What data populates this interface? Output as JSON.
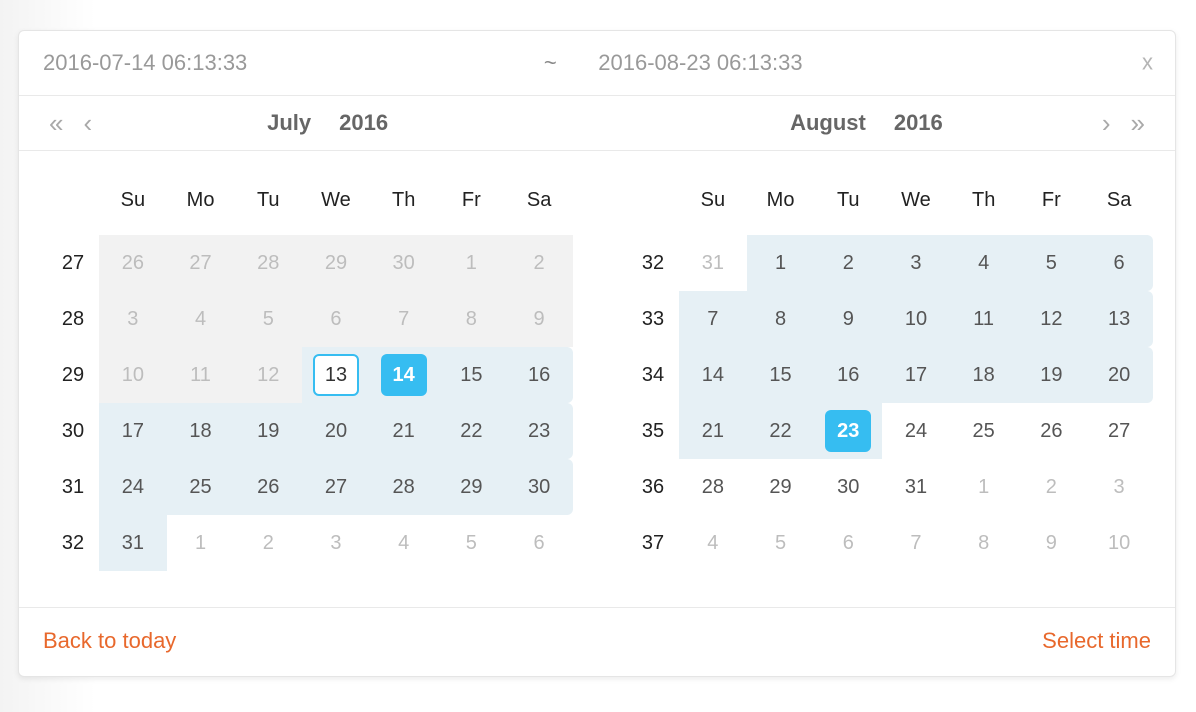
{
  "header": {
    "start_value": "2016-07-14 06:13:33",
    "range_separator": "~",
    "end_value": "2016-08-23 06:13:33",
    "close_label": "x"
  },
  "nav": {
    "prev_year": "«",
    "prev_month": "‹",
    "next_month": "›",
    "next_year": "»",
    "left_month": "July",
    "left_year": "2016",
    "right_month": "August",
    "right_year": "2016"
  },
  "weekdays": [
    "Su",
    "Mo",
    "Tu",
    "We",
    "Th",
    "Fr",
    "Sa"
  ],
  "footer": {
    "back_to_today": "Back to today",
    "select_time": "Select time"
  },
  "calendars": {
    "left": {
      "today": 13,
      "selected": 14,
      "rows": [
        {
          "week": 27,
          "days": [
            {
              "n": 26,
              "out": true,
              "outbg": true
            },
            {
              "n": 27,
              "out": true,
              "outbg": true
            },
            {
              "n": 28,
              "out": true,
              "outbg": true
            },
            {
              "n": 29,
              "out": true,
              "outbg": true
            },
            {
              "n": 30,
              "out": true,
              "outbg": true
            },
            {
              "n": 1,
              "out": true,
              "outbg": true
            },
            {
              "n": 2,
              "out": true,
              "outbg": true
            }
          ]
        },
        {
          "week": 28,
          "days": [
            {
              "n": 3,
              "out": true,
              "outbg": true
            },
            {
              "n": 4,
              "out": true,
              "outbg": true
            },
            {
              "n": 5,
              "out": true,
              "outbg": true
            },
            {
              "n": 6,
              "out": true,
              "outbg": true
            },
            {
              "n": 7,
              "out": true,
              "outbg": true
            },
            {
              "n": 8,
              "out": true,
              "outbg": true
            },
            {
              "n": 9,
              "out": true,
              "outbg": true
            }
          ]
        },
        {
          "week": 29,
          "days": [
            {
              "n": 10,
              "out": true,
              "outbg": true
            },
            {
              "n": 11,
              "out": true,
              "outbg": true
            },
            {
              "n": 12,
              "out": true,
              "outbg": true
            },
            {
              "n": 13,
              "today": true,
              "range": true
            },
            {
              "n": 14,
              "selected": true,
              "range": true
            },
            {
              "n": 15,
              "range": true
            },
            {
              "n": 16,
              "range": true
            }
          ]
        },
        {
          "week": 30,
          "days": [
            {
              "n": 17,
              "range": true
            },
            {
              "n": 18,
              "range": true
            },
            {
              "n": 19,
              "range": true
            },
            {
              "n": 20,
              "range": true
            },
            {
              "n": 21,
              "range": true
            },
            {
              "n": 22,
              "range": true
            },
            {
              "n": 23,
              "range": true
            }
          ]
        },
        {
          "week": 31,
          "days": [
            {
              "n": 24,
              "range": true
            },
            {
              "n": 25,
              "range": true
            },
            {
              "n": 26,
              "range": true
            },
            {
              "n": 27,
              "range": true
            },
            {
              "n": 28,
              "range": true
            },
            {
              "n": 29,
              "range": true
            },
            {
              "n": 30,
              "range": true
            }
          ]
        },
        {
          "week": 32,
          "days": [
            {
              "n": 31,
              "range": true
            },
            {
              "n": 1,
              "out": true
            },
            {
              "n": 2,
              "out": true
            },
            {
              "n": 3,
              "out": true
            },
            {
              "n": 4,
              "out": true
            },
            {
              "n": 5,
              "out": true
            },
            {
              "n": 6,
              "out": true
            }
          ]
        }
      ]
    },
    "right": {
      "selected": 23,
      "rows": [
        {
          "week": 32,
          "days": [
            {
              "n": 31,
              "out": true
            },
            {
              "n": 1,
              "range": true
            },
            {
              "n": 2,
              "range": true
            },
            {
              "n": 3,
              "range": true
            },
            {
              "n": 4,
              "range": true
            },
            {
              "n": 5,
              "range": true
            },
            {
              "n": 6,
              "range": true
            }
          ]
        },
        {
          "week": 33,
          "days": [
            {
              "n": 7,
              "range": true
            },
            {
              "n": 8,
              "range": true
            },
            {
              "n": 9,
              "range": true
            },
            {
              "n": 10,
              "range": true
            },
            {
              "n": 11,
              "range": true
            },
            {
              "n": 12,
              "range": true
            },
            {
              "n": 13,
              "range": true
            }
          ]
        },
        {
          "week": 34,
          "days": [
            {
              "n": 14,
              "range": true
            },
            {
              "n": 15,
              "range": true
            },
            {
              "n": 16,
              "range": true
            },
            {
              "n": 17,
              "range": true
            },
            {
              "n": 18,
              "range": true
            },
            {
              "n": 19,
              "range": true
            },
            {
              "n": 20,
              "range": true
            }
          ]
        },
        {
          "week": 35,
          "days": [
            {
              "n": 21,
              "range": true
            },
            {
              "n": 22,
              "range": true
            },
            {
              "n": 23,
              "selected": true,
              "range": true
            },
            {
              "n": 24
            },
            {
              "n": 25
            },
            {
              "n": 26
            },
            {
              "n": 27
            }
          ]
        },
        {
          "week": 36,
          "days": [
            {
              "n": 28
            },
            {
              "n": 29
            },
            {
              "n": 30
            },
            {
              "n": 31
            },
            {
              "n": 1,
              "out": true
            },
            {
              "n": 2,
              "out": true
            },
            {
              "n": 3,
              "out": true
            }
          ]
        },
        {
          "week": 37,
          "days": [
            {
              "n": 4,
              "out": true
            },
            {
              "n": 5,
              "out": true
            },
            {
              "n": 6,
              "out": true
            },
            {
              "n": 7,
              "out": true
            },
            {
              "n": 8,
              "out": true
            },
            {
              "n": 9,
              "out": true
            },
            {
              "n": 10,
              "out": true
            }
          ]
        }
      ]
    }
  }
}
